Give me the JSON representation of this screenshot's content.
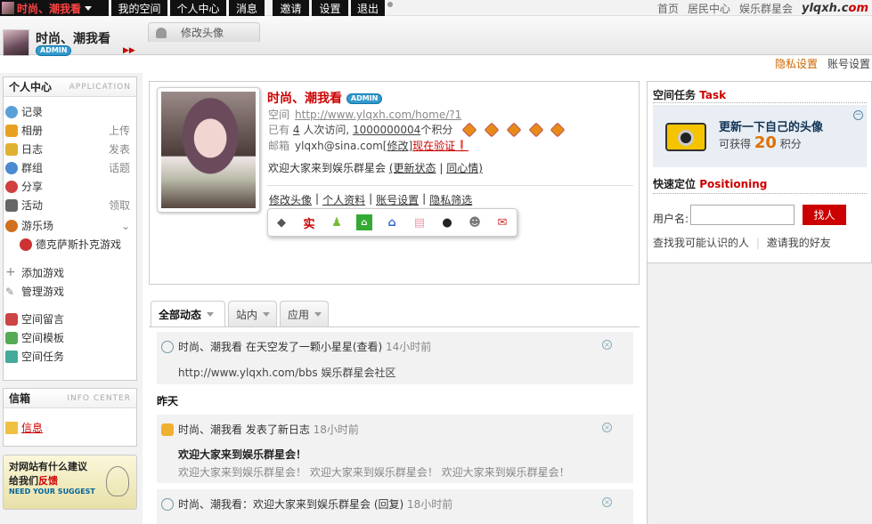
{
  "topbar": {
    "username": "时尚、潮我看",
    "nav": [
      "我的空间",
      "个人中心",
      "消息",
      "邀请",
      "设置",
      "退出"
    ],
    "right_links": [
      "首页",
      "居民中心",
      "娱乐群星会"
    ],
    "logo_text": "ylqxh.c",
    "logo_suffix": "om"
  },
  "header": {
    "name": "时尚、潮我看",
    "badge": "ADMIN",
    "edit_avatar_tab": "修改头像",
    "privacy_settings": "隐私设置",
    "account_settings": "账号设置"
  },
  "sidebar": {
    "title": "个人中心",
    "subtitle": "APPLICATION",
    "items": [
      {
        "label": "记录",
        "right": "",
        "icon": "record-icon",
        "color": "#5aa0d8"
      },
      {
        "label": "相册",
        "right": "上传",
        "icon": "album-icon",
        "color": "#e8a020"
      },
      {
        "label": "日志",
        "right": "发表",
        "icon": "blog-icon",
        "color": "#e0b030"
      },
      {
        "label": "群组",
        "right": "话题",
        "icon": "group-icon",
        "color": "#4a8ad0"
      },
      {
        "label": "分享",
        "right": "",
        "icon": "share-icon",
        "color": "#d04040"
      },
      {
        "label": "活动",
        "right": "领取",
        "icon": "event-icon",
        "color": "#666666"
      },
      {
        "label": "游乐场",
        "right": "",
        "icon": "playground-icon",
        "color": "#d07020"
      }
    ],
    "game": "德克萨斯扑克游戏",
    "game_items": [
      {
        "label": "添加游戏",
        "icon": "add-game-icon"
      },
      {
        "label": "管理游戏",
        "icon": "manage-game-icon"
      }
    ],
    "space_items": [
      {
        "label": "空间留言",
        "icon": "guestbook-icon"
      },
      {
        "label": "空间模板",
        "icon": "template-icon"
      },
      {
        "label": "空间任务",
        "icon": "task-icon"
      }
    ]
  },
  "inbox": {
    "title": "信箱",
    "subtitle": "INFO CENTER",
    "message": "信息"
  },
  "suggest": {
    "line1": "对网站有什么建议",
    "line2a": "给我们",
    "line2b": "反馈",
    "line3": "NEED YOUR SUGGEST"
  },
  "profile": {
    "name": "时尚、潮我看",
    "badge": "ADMIN",
    "space_label": "空间",
    "space_url": "http://www.ylqxh.com/home/?1",
    "visits_prefix": "已有",
    "visits": "4",
    "visits_mid": "人次访问,",
    "points": "1000000004",
    "points_suffix": "个积分",
    "email_label": "邮箱",
    "email": "ylqxh@sina.com",
    "email_edit": "[修改]",
    "email_verify": "现在验证",
    "status_text": "欢迎大家来到娱乐群星会",
    "update_status": "(更新状态",
    "same_mood": "同心情)",
    "links": [
      "修改头像",
      "个人资料",
      "账号设置",
      "隐私筛选"
    ],
    "icons": [
      "diamond-icon",
      "shi-icon",
      "person-icon",
      "house-icon",
      "home-icon",
      "cake-icon",
      "qq-icon",
      "friends-icon",
      "gmail-icon"
    ],
    "shi_char": "实"
  },
  "tabs": [
    {
      "label": "全部动态",
      "active": true
    },
    {
      "label": "站内",
      "active": false
    },
    {
      "label": "应用",
      "active": false
    }
  ],
  "feed": {
    "item1": {
      "text": "时尚、潮我看 在天空发了一颗小星星(查看)",
      "time": "14小时前",
      "body": "http://www.ylqxh.com/bbs 娱乐群星会社区"
    },
    "yesterday": "昨天",
    "item2": {
      "text": "时尚、潮我看 发表了新日志",
      "time": "18小时前",
      "title": "欢迎大家来到娱乐群星会！",
      "body": "欢迎大家来到娱乐群星会！ 欢迎大家来到娱乐群星会！ 欢迎大家来到娱乐群星会！"
    },
    "item3": {
      "text": "时尚、潮我看：欢迎大家来到娱乐群星会 (回复)",
      "time": "18小时前"
    }
  },
  "task": {
    "title": "空间任务",
    "title_en": "Task",
    "headline": "更新一下自己的头像",
    "reward_prefix": "可获得",
    "reward": "20",
    "reward_suffix": "积分"
  },
  "locate": {
    "title": "快速定位",
    "title_en": "Positioning",
    "username_label": "用户名:",
    "find_button": "找人",
    "find_known": "查找我可能认识的人",
    "invite": "邀请我的好友"
  }
}
